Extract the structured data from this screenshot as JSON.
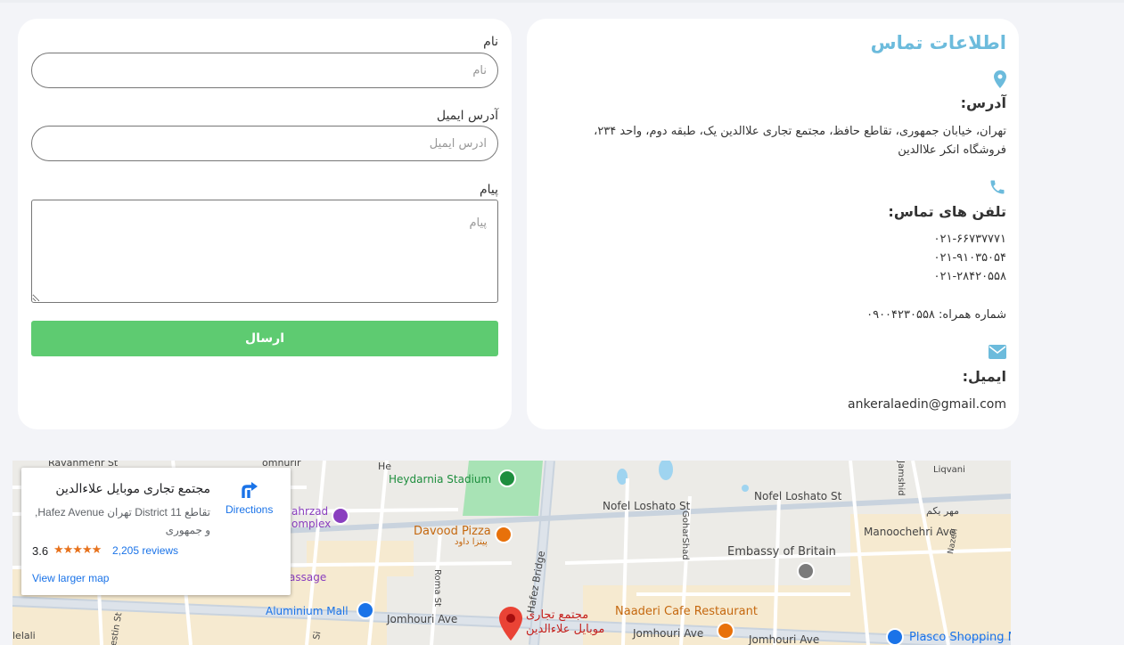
{
  "form": {
    "name_label": "نام",
    "name_placeholder": "نام",
    "email_label": "آدرس ایمیل",
    "email_placeholder": "آدرس ایمیل",
    "message_label": "پیام",
    "message_placeholder": "پیام",
    "submit_label": "ارسال"
  },
  "info": {
    "title": "اطلاعات تماس",
    "address_heading": "آدرس:",
    "address_line1": "تهران، خیابان جمهوری، تقاطع حافظ، مجتمع تجاری علاالدین یک، طبقه دوم، واحد ۲۳۴،",
    "address_line2": "فروشگاه انکر علاالدین",
    "phones_heading": "تلفن های تماس:",
    "phones": [
      "۰۲۱-۶۶۷۳۷۷۷۱",
      "۰۲۱-۹۱۰۳۵۰۵۴",
      "۰۲۱-۲۸۴۲۰۵۵۸"
    ],
    "mobile": "شماره همراه: ۰۹۰۰۴۲۳۰۵۵۸",
    "email_heading": "ایمیل:",
    "email": "ankeralaedin@gmail.com",
    "accent_color": "#6cbbdc",
    "icons": [
      "map-pin-icon",
      "phone-icon",
      "envelope-icon"
    ]
  },
  "map_card": {
    "place_name": "مجتمع تجاری موبایل علاءالدین",
    "address_line1": "تقاطع District 11 تهران Hafez Avenue,",
    "address_line2": "و جمهوری",
    "rating": "3.6",
    "stars": "★★★★★",
    "reviews": "2,205 reviews",
    "view_larger": "View larger map",
    "directions": "Directions"
  },
  "map": {
    "labels": {
      "ravanmehr": "Ravanmehr St",
      "jomhurir": "omhurir",
      "heydarnia": "Heydarnia Stadium",
      "complex": "ahrzad",
      "complex2": "omplex",
      "davood": "Davood Pizza",
      "davood_fa": "پیتزا داود",
      "nofel1": "Nofel Loshato St",
      "nofel2": "Nofel Loshato St",
      "gohar": "GoharShad",
      "hafez_bridge": "Hafez Bridge",
      "embassy": "Embassy of Britain",
      "manoochehri": "Manoochehri Ave",
      "mehr": "مهر یکم",
      "liqvani": "Liqvani",
      "jamshid": "Jamshid",
      "nazeri": "Nazeri",
      "passage": "assage",
      "roma": "Roma St",
      "aluminium": "Aluminium Mall",
      "jomhouri1": "Jomhouri Ave",
      "jomhouri2": "Jomhouri Ave",
      "jomhouri3": "Jomhouri Ave",
      "naaderi": "Naaderi Cafe Restaurant",
      "plasco": "Plasco Shopping M",
      "target1": "مجتمع تجاری",
      "target2": "موبایل علاءالدین",
      "lalai": "lelali",
      "estin": "estin St",
      "he": "He",
      "si": "Si"
    }
  }
}
